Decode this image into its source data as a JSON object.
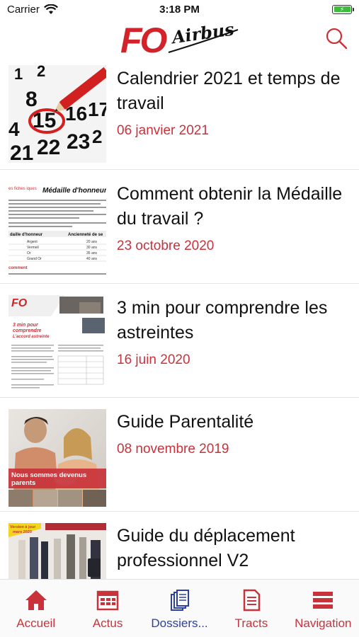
{
  "status_bar": {
    "carrier": "Carrier",
    "time": "3:18 PM"
  },
  "header": {
    "logo_text": "FO Airbus",
    "logo_fo": "FO",
    "logo_airbus": "Airbus",
    "search_icon": "search-icon"
  },
  "articles": [
    {
      "title": "Calendrier 2021 et temps de travail",
      "date": "06 janvier 2021",
      "thumb": "calendar-thumbnail"
    },
    {
      "title": "Comment obtenir la Médaille du travail ?",
      "date": "23 octobre 2020",
      "thumb": "document-medaille-thumbnail",
      "thumb_text": {
        "header": "Médaille d'honneur du",
        "side": "es fiches iques",
        "table_head_1": "daille d'honneur",
        "table_head_2": "Ancienneté de se",
        "rows": [
          [
            "Argent",
            "20 ans"
          ],
          [
            "Vermeil",
            "30 ans"
          ],
          [
            "Or",
            "35 ans"
          ],
          [
            "Grand Or",
            "40 ans"
          ]
        ],
        "footer": "comment"
      }
    },
    {
      "title": "3 min pour comprendre les astreintes",
      "date": "16 juin 2020",
      "thumb": "document-astreintes-thumbnail",
      "thumb_text": {
        "logo": "FO",
        "heading_1": "3 min pour",
        "heading_2": "comprendre",
        "heading_3": "L'accord astreinte"
      }
    },
    {
      "title": "Guide Parentalité",
      "date": "08 novembre 2019",
      "thumb": "parents-photo-thumbnail",
      "thumb_text": {
        "banner_1": "Nous sommes devenus",
        "banner_2": "parents"
      }
    },
    {
      "title": "Guide du déplacement professionnel V2",
      "date": "",
      "thumb": "travel-guide-thumbnail",
      "thumb_text": {
        "badge_1": "Version à jour",
        "badge_2": "mars 2020"
      }
    }
  ],
  "tabs": [
    {
      "label": "Accueil",
      "icon": "home-icon",
      "active": false
    },
    {
      "label": "Actus",
      "icon": "news-icon",
      "active": false
    },
    {
      "label": "Dossiers...",
      "icon": "documents-icon",
      "active": true
    },
    {
      "label": "Tracts",
      "icon": "tract-icon",
      "active": false
    },
    {
      "label": "Navigation",
      "icon": "menu-icon",
      "active": false
    }
  ],
  "colors": {
    "accent": "#c8333b",
    "active_tab": "#2c3fa6",
    "battery": "#3bbf3b"
  }
}
